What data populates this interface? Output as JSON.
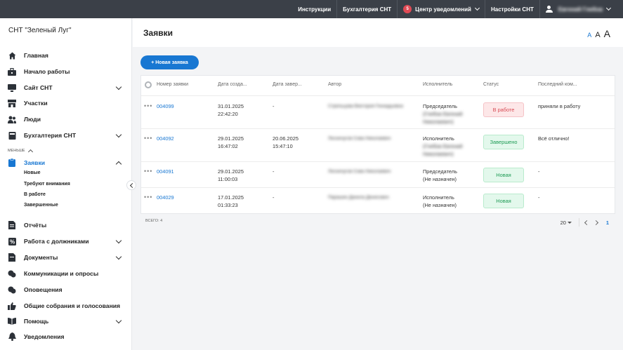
{
  "topbar": {
    "instructions": "Инструкции",
    "accounting": "Бухгалтерия СНТ",
    "notifications_badge": "5",
    "notifications": "Центр уведомлений",
    "settings": "Настройки СНТ",
    "user_name": "Евгений Глебов"
  },
  "sidebar": {
    "org_title": "СНТ \"Зеленый Луг\"",
    "items": [
      {
        "label": "Главная",
        "icon": "home-icon"
      },
      {
        "label": "Начало работы",
        "icon": "start-icon"
      },
      {
        "label": "Сайт СНТ",
        "icon": "monitor-icon"
      },
      {
        "label": "Участки",
        "icon": "plots-icon"
      },
      {
        "label": "Люди",
        "icon": "people-icon"
      },
      {
        "label": "Бухгалтерия СНТ",
        "icon": "accounting-icon"
      }
    ],
    "less_label": "МЕНЬШЕ",
    "requests": {
      "label": "Заявки",
      "sub": [
        "Новые",
        "Требуют внимания",
        "В работе",
        "Завершенные"
      ]
    },
    "items_bottom": [
      {
        "label": "Отчёты",
        "icon": "report-icon"
      },
      {
        "label": "Работа с должниками",
        "icon": "percent-icon"
      },
      {
        "label": "Документы",
        "icon": "documents-icon"
      },
      {
        "label": "Коммуникации и опросы",
        "icon": "chat-icon"
      },
      {
        "label": "Оповещения",
        "icon": "alert-icon"
      },
      {
        "label": "Общие собрания и голосования",
        "icon": "thumbs-up-icon"
      },
      {
        "label": "Помощь",
        "icon": "book-icon"
      },
      {
        "label": "Уведомления",
        "icon": "bell-icon"
      }
    ]
  },
  "page": {
    "title": "Заявки",
    "font_small": "A",
    "font_medium": "A",
    "font_large": "A",
    "new_button": "+ Новая заявка"
  },
  "table": {
    "columns": [
      "Номер заявки",
      "Дата созда...",
      "Дата завер...",
      "Автор",
      "Исполнитель",
      "Статус",
      "Последний ком..."
    ],
    "rows": [
      {
        "number": "004099",
        "created_date": "31.01.2025",
        "created_time": "22:42:20",
        "closed_date": "-",
        "closed_time": "",
        "author": "Стрельцова Виктория Геннадьевна",
        "executor_1": "Председатель",
        "executor_2": "(Глебов Евгений",
        "executor_3": "Николаевич)",
        "status": "В работе",
        "status_kind": "inwork",
        "comment": "приняли в работу"
      },
      {
        "number": "004092",
        "created_date": "29.01.2025",
        "created_time": "16:47:02",
        "closed_date": "20.06.2025",
        "closed_time": "15:47:10",
        "author": "Лесничугов Сова Николаевич",
        "executor_1": "Исполнитель",
        "executor_2": "(Глебов Евгений",
        "executor_3": "Николаевич)",
        "status": "Завершено",
        "status_kind": "done",
        "comment": "Всё отлично!"
      },
      {
        "number": "004091",
        "created_date": "29.01.2025",
        "created_time": "11:00:03",
        "closed_date": "-",
        "closed_time": "",
        "author": "Лесничугов Сова Николаевич",
        "executor_1": "Председатель",
        "executor_2": "(Не назначен)",
        "executor_3": "",
        "status": "Новая",
        "status_kind": "new",
        "comment": "-"
      },
      {
        "number": "004029",
        "created_date": "17.01.2025",
        "created_time": "01:33:23",
        "closed_date": "-",
        "closed_time": "",
        "author": "Парашин Данила Денисович",
        "executor_1": "Исполнитель",
        "executor_2": "(Не назначен)",
        "executor_3": "",
        "status": "Новая",
        "status_kind": "new",
        "comment": "-"
      }
    ],
    "total_label": "ВСЕГО: 4",
    "page_size": "20",
    "current_page": "1"
  },
  "colors": {
    "accent": "#1877d2",
    "topbar": "#3b4048",
    "status_inwork": "#d84b55",
    "status_done": "#1e9b55"
  }
}
